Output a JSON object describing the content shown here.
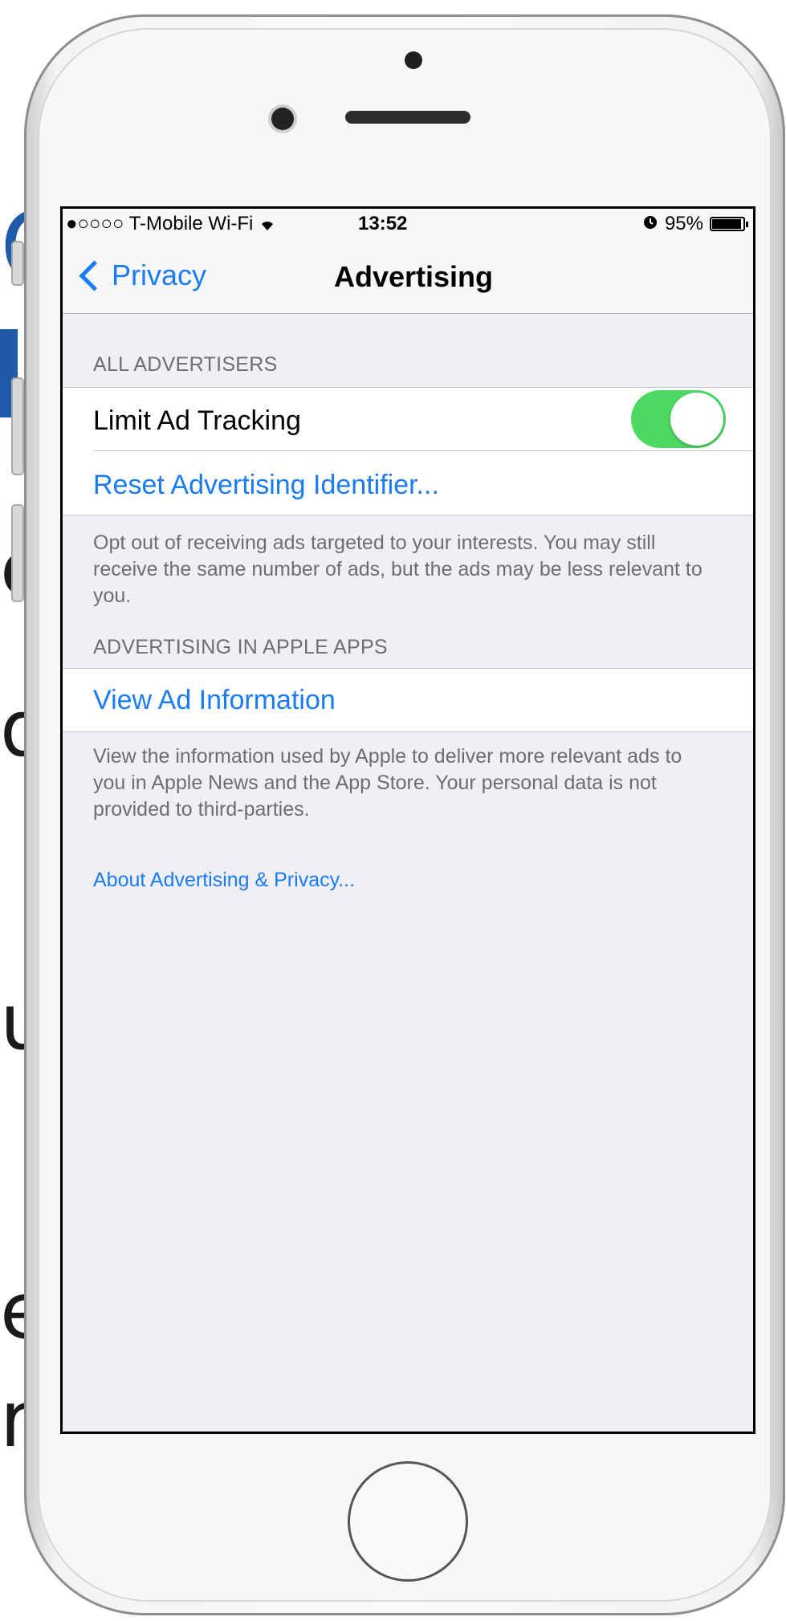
{
  "status_bar": {
    "carrier": "●○○○○ T-Mobile Wi-Fi",
    "wifi_icon": "wifi-icon",
    "time": "13:52",
    "alarm_icon": "alarm-icon",
    "battery_percent": "95%",
    "battery_level": 0.95
  },
  "navbar": {
    "back_label": "Privacy",
    "title": "Advertising"
  },
  "sections": {
    "all_advertisers": {
      "header": "ALL ADVERTISERS",
      "limit_ad_tracking_label": "Limit Ad Tracking",
      "limit_ad_tracking_on": true,
      "reset_label": "Reset Advertising Identifier...",
      "footer": "Opt out of receiving ads targeted to your interests. You may still receive the same number of ads, but the ads may be less relevant to you."
    },
    "apple_apps": {
      "header": "ADVERTISING IN APPLE APPS",
      "view_ad_info_label": "View Ad Information",
      "footer": "View the information used by Apple to deliver more relevant ads to you in Apple News and the App Store. Your personal data is not provided to third-parties."
    },
    "about_link": "About Advertising & Privacy..."
  },
  "colors": {
    "accent": "#1a7cf5",
    "toggle_on": "#4cd964",
    "background": "#efeff4"
  }
}
